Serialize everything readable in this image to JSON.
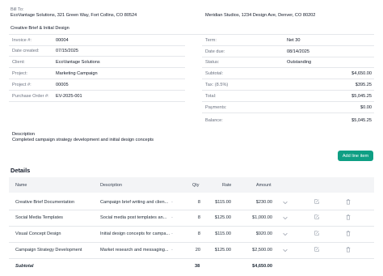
{
  "bill_to_label": "Bill To:",
  "bill_to_address": "EcoVantage Solutions, 321 Green Way, Fort Collins, CO 80524",
  "from_address": "Meridian Studios, 1234 Design Ave, Denver, CO 80202",
  "invoice_title": "Creative Brief & Initial Design",
  "left_fields": [
    {
      "label": "Invoice #:",
      "value": "00004"
    },
    {
      "label": "Date created:",
      "value": "07/15/2025"
    },
    {
      "label": "Client:",
      "value": "EcoVantage Solutions"
    },
    {
      "label": "Project:",
      "value": "Marketing Campaign"
    },
    {
      "label": "Project #:",
      "value": "00005"
    },
    {
      "label": "Purchase Order #:",
      "value": "EV-2025-001"
    }
  ],
  "right_fields": [
    {
      "label": "Term:",
      "value": "Net 30"
    },
    {
      "label": "Date due:",
      "value": "08/14/2025"
    },
    {
      "label": "Status:",
      "value": "Outstanding"
    },
    {
      "label": "Subtotal:",
      "value": "$4,650.00"
    },
    {
      "label": "Tax: (8.5%)",
      "value": "$395.25"
    },
    {
      "label": "Total:",
      "value": "$5,045.25"
    },
    {
      "label": "Payments:",
      "value": "$0.00"
    },
    {
      "label": "Balance:",
      "value": "$5,045.25"
    }
  ],
  "description_label": "Description",
  "description_text": "Completed campaign strategy development and initial design concepts",
  "add_line_item_label": "Add line item",
  "details_title": "Details",
  "table": {
    "headers": {
      "name": "Name",
      "description": "Description",
      "qty": "Qty",
      "rate": "Rate",
      "amount": "Amount"
    },
    "rows": [
      {
        "name": "Creative Brief Documentation",
        "description": "Campaign brief writing and clien...",
        "qty": "8",
        "rate": "$115.00",
        "amount": "$230.00"
      },
      {
        "name": "Social Media Templates",
        "description": "Social media post templates an...",
        "qty": "8",
        "rate": "$125.00",
        "amount": "$1,000.00"
      },
      {
        "name": "Visual Concept Design",
        "description": "Initial design concepts for campa...",
        "qty": "8",
        "rate": "$115.00",
        "amount": "$920.00"
      },
      {
        "name": "Campaign Strategy Development",
        "description": "Market research and messaging...",
        "qty": "20",
        "rate": "$125.00",
        "amount": "$2,500.00"
      }
    ],
    "subtotal": {
      "label": "Subtotal",
      "qty": "38",
      "amount": "$4,650.00"
    }
  },
  "icons": {
    "edit": "edit-icon",
    "delete": "trash-icon",
    "expand": "chevron-down-icon"
  },
  "colors": {
    "accent": "#0f9f84",
    "header_bg": "#f3f4f6",
    "border": "#e5e7eb"
  }
}
